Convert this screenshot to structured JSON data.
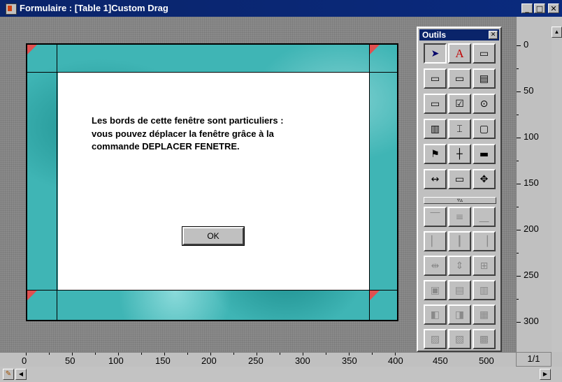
{
  "window": {
    "title": "Formulaire : [Table 1]Custom Drag",
    "minimize": "_",
    "maximize": "□",
    "close": "✕"
  },
  "form": {
    "message_lines": [
      "Les bords de cette fenêtre sont particuliers :",
      "vous pouvez déplacer la fenêtre grâce à la",
      "commande DEPLACER FENETRE."
    ],
    "ok_label": "OK",
    "colors": {
      "border_teal": "#3fb5b5",
      "corner_red": "#e05050",
      "background": "#8a8a8a"
    }
  },
  "palette": {
    "title": "Outils",
    "close": "✕",
    "divider": "▿▵",
    "tools": [
      {
        "name": "arrow-tool-icon",
        "glyph": "➤"
      },
      {
        "name": "text-tool-icon",
        "glyph": "A"
      },
      {
        "name": "field-tool-icon",
        "glyph": "▭"
      },
      {
        "name": "enterable-field-icon",
        "glyph": "▭"
      },
      {
        "name": "line-field-icon",
        "glyph": "▭"
      },
      {
        "name": "picture-field-icon",
        "glyph": "▤"
      },
      {
        "name": "button-tool-icon",
        "glyph": "▭"
      },
      {
        "name": "checkbox-tool-icon",
        "glyph": "☑"
      },
      {
        "name": "radio-tool-icon",
        "glyph": "⊙"
      },
      {
        "name": "scrollable-area-icon",
        "glyph": "▥"
      },
      {
        "name": "list-box-icon",
        "glyph": "⌶"
      },
      {
        "name": "window-tool-icon",
        "glyph": "▢"
      },
      {
        "name": "plugin-tool-icon",
        "glyph": "⚑"
      },
      {
        "name": "grid-tool-icon",
        "glyph": "┼"
      },
      {
        "name": "ruler-tool-icon",
        "glyph": "▬"
      },
      {
        "name": "line-tool-icon",
        "glyph": "↔"
      },
      {
        "name": "rectangle-tool-icon",
        "glyph": "▭"
      },
      {
        "name": "move-tool-icon",
        "glyph": "✥"
      },
      {
        "name": "align-top-icon",
        "glyph": "⎺"
      },
      {
        "name": "align-center-v-icon",
        "glyph": "≡"
      },
      {
        "name": "align-bottom-icon",
        "glyph": "⎽"
      },
      {
        "name": "align-left-icon",
        "glyph": "▏"
      },
      {
        "name": "align-center-h-icon",
        "glyph": "┃"
      },
      {
        "name": "align-right-icon",
        "glyph": "▕"
      },
      {
        "name": "distribute-h-icon",
        "glyph": "⇹"
      },
      {
        "name": "distribute-v-icon",
        "glyph": "⇕"
      },
      {
        "name": "align-grid-icon",
        "glyph": "⊞"
      },
      {
        "name": "group-icon",
        "glyph": "▣"
      },
      {
        "name": "ungroup-icon",
        "glyph": "▤"
      },
      {
        "name": "lock-icon",
        "glyph": "▥"
      },
      {
        "name": "bring-front-icon",
        "glyph": "◧"
      },
      {
        "name": "send-back-icon",
        "glyph": "◨"
      },
      {
        "name": "duplicate-icon",
        "glyph": "▦"
      },
      {
        "name": "page-icon",
        "glyph": "▨"
      },
      {
        "name": "tab-order-icon",
        "glyph": "▧"
      },
      {
        "name": "properties-icon",
        "glyph": "▩"
      }
    ]
  },
  "ruler": {
    "vertical_labels": [
      "0",
      "50",
      "100",
      "150",
      "200",
      "250",
      "300"
    ],
    "horizontal_labels": [
      "0",
      "50",
      "100",
      "150",
      "200",
      "250",
      "300",
      "350",
      "400",
      "450",
      "500"
    ],
    "page": "1/1"
  }
}
